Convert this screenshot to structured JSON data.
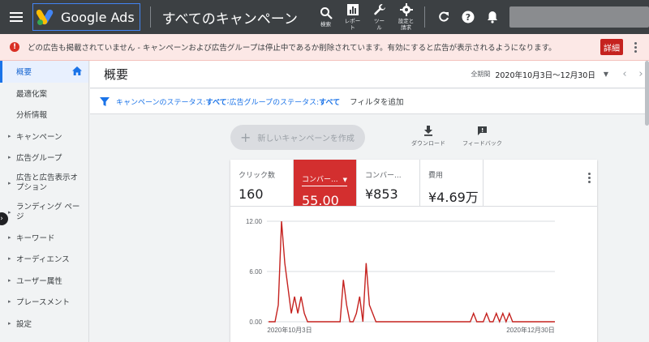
{
  "header": {
    "product_name": "Google Ads",
    "page_title": "すべてのキャンペーン",
    "tools": [
      {
        "label": "検索",
        "icon": "search-icon"
      },
      {
        "label": "レポー\nト",
        "icon": "reports-icon"
      },
      {
        "label": "ツー\nル",
        "icon": "tools-icon"
      },
      {
        "label": "設定と\n請求",
        "icon": "settings-icon"
      }
    ]
  },
  "alert": {
    "message": "どの広告も掲載されていません - キャンペーンおよび広告グループは停止中であるか削除されています。有効にすると広告が表示されるようになります。",
    "button_label": "詳細"
  },
  "sidebar": {
    "items": [
      {
        "label": "概要"
      },
      {
        "label": "最適化案"
      },
      {
        "label": "分析情報"
      },
      {
        "label": "キャンペーン"
      },
      {
        "label": "広告グループ"
      },
      {
        "label": "広告と広告表示オ\nプション"
      },
      {
        "label": "ランディング ペー\nジ"
      },
      {
        "label": "キーワード"
      },
      {
        "label": "オーディエンス"
      },
      {
        "label": "ユーザー属性"
      },
      {
        "label": "プレースメント"
      },
      {
        "label": "設定"
      }
    ]
  },
  "main": {
    "title": "概要",
    "period_label": "全期間",
    "period_value": "2020年10月3日〜12月30日"
  },
  "filter": {
    "campaign_status_label": "キャンペーンのステータス: ",
    "campaign_status_value": "すべて",
    "separator": "; ",
    "adgroup_status_label": "広告グループのステータス: ",
    "adgroup_status_value": "すべて",
    "add_filter": "フィルタを追加"
  },
  "actions": {
    "create_campaign": "新しいキャンペーンを作成",
    "download": "ダウンロード",
    "feedback": "フィードバック"
  },
  "metrics": [
    {
      "label": "クリック数",
      "value": "160"
    },
    {
      "label": "コンバー...",
      "value": "55.00"
    },
    {
      "label": "コンバー...",
      "value": "¥853"
    },
    {
      "label": "費用",
      "value": "¥4.69万"
    }
  ],
  "colors": {
    "topbar": "#3c4043",
    "accent_red": "#d32f2f",
    "link_blue": "#1a73e8"
  },
  "chart_data": {
    "type": "line",
    "title": "",
    "xlabel": "",
    "ylabel": "",
    "ylim": [
      0,
      12
    ],
    "yticks": [
      "12.00",
      "6.00",
      "0.00"
    ],
    "xticks": [
      "2020年10月3日",
      "2020年12月30日"
    ],
    "series": [
      {
        "values": [
          0,
          0,
          0,
          2,
          12,
          7,
          4,
          1,
          3,
          1,
          3,
          1,
          0,
          0,
          0,
          0,
          0,
          0,
          0,
          0,
          0,
          0,
          0,
          5,
          2,
          0,
          0,
          1,
          3,
          0,
          7,
          2,
          1,
          0,
          0,
          0,
          0,
          0,
          0,
          0,
          0,
          0,
          0,
          0,
          0,
          0,
          0,
          0,
          0,
          0,
          0,
          0,
          0,
          0,
          0,
          0,
          0,
          0,
          0,
          0,
          0,
          0,
          0,
          1,
          0,
          0,
          0,
          1,
          0,
          0,
          1,
          0,
          1,
          0,
          1,
          0,
          0,
          0,
          0,
          0,
          0,
          0,
          0,
          0,
          0,
          0,
          0,
          0,
          0
        ]
      }
    ]
  }
}
